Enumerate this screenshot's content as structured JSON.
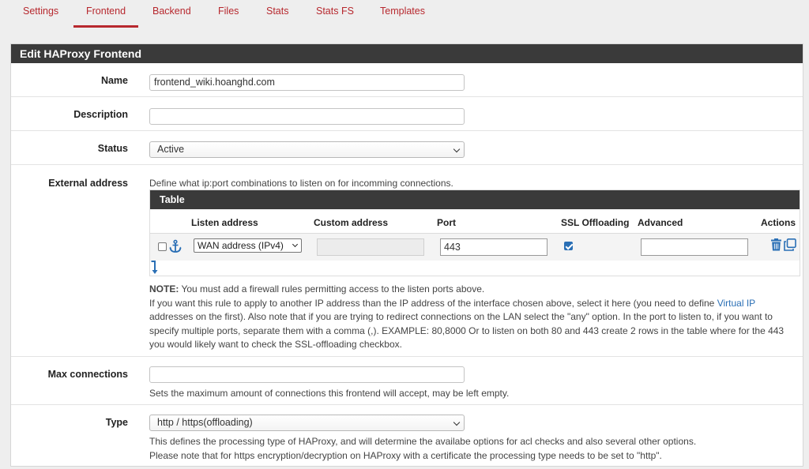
{
  "tabs": [
    {
      "label": "Settings"
    },
    {
      "label": "Frontend",
      "active": true
    },
    {
      "label": "Backend"
    },
    {
      "label": "Files"
    },
    {
      "label": "Stats"
    },
    {
      "label": "Stats FS"
    },
    {
      "label": "Templates"
    }
  ],
  "panel": {
    "title": "Edit HAProxy Frontend"
  },
  "form": {
    "name": {
      "label": "Name",
      "value": "frontend_wiki.hoanghd.com"
    },
    "description": {
      "label": "Description",
      "value": ""
    },
    "status": {
      "label": "Status",
      "value": "Active"
    },
    "external": {
      "label": "External address",
      "help": "Define what ip:port combinations to listen on for incomming connections.",
      "table": {
        "title": "Table",
        "headers": [
          "Listen address",
          "Custom address",
          "Port",
          "SSL Offloading",
          "Advanced",
          "Actions"
        ],
        "row": {
          "selected": false,
          "listen_address": "WAN address (IPv4)",
          "custom_address": "",
          "port": "443",
          "ssl_offloading": true,
          "advanced": ""
        }
      },
      "note_bold": "NOTE:",
      "note_rest": " You must add a firewall rules permitting access to the listen ports above.",
      "note_line2a": "If you want this rule to apply to another IP address than the IP address of the interface chosen above, select it here (you need to define ",
      "note_link": "Virtual IP",
      "note_line3": "addresses on the first). Also note that if you are trying to redirect connections on the LAN select the \"any\" option. In the port to listen to, if you want to",
      "note_line4": "specify multiple ports, separate them with a comma (,). EXAMPLE: 80,8000 Or to listen on both 80 and 443 create 2 rows in the table where for the 443",
      "note_line5": "you would likely want to check the SSL-offloading checkbox."
    },
    "max_connections": {
      "label": "Max connections",
      "value": "",
      "help": "Sets the maximum amount of connections this frontend will accept, may be left empty."
    },
    "type": {
      "label": "Type",
      "value": "http / https(offloading)",
      "help1": "This defines the processing type of HAProxy, and will determine the availabe options for acl checks and also several other options.",
      "help2": "Please note that for https encryption/decryption on HAProxy with a certificate the processing type needs to be set to \"http\"."
    }
  },
  "colors": {
    "accent": "#b7282e",
    "header": "#3a3a3a",
    "link": "#2a6fb5"
  }
}
